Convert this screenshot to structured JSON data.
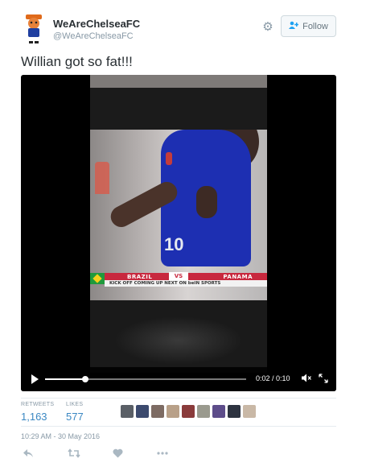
{
  "user": {
    "display_name": "WeAreChelseaFC",
    "screen_name": "@WeAreChelseaFC",
    "follow_label": "Follow",
    "follow_icon": "add-user-icon",
    "settings_icon": "gear-icon"
  },
  "tweet": {
    "text": "Willian got so fat!!!",
    "timestamp": "10:29 AM - 30 May 2016"
  },
  "video": {
    "overlay": {
      "team_left": "BRAZIL",
      "vs": "VS",
      "team_right": "PANAMA",
      "ticker": "KICK OFF COMING UP NEXT ON beIN SPORTS",
      "shirt_number": "10"
    },
    "time_display": "0:02 / 0:10",
    "progress_fraction": 0.2,
    "play_icon": "play-icon",
    "mute_icon": "mute-icon",
    "fullscreen_icon": "fullscreen-icon"
  },
  "stats": {
    "retweets_label": "RETWEETS",
    "retweets_value": "1,163",
    "likes_label": "LIKES",
    "likes_value": "577"
  },
  "likers": [
    {
      "color": "#5a5f66"
    },
    {
      "color": "#3c4a6e"
    },
    {
      "color": "#7d6b63"
    },
    {
      "color": "#b8a088"
    },
    {
      "color": "#8a3b3b"
    },
    {
      "color": "#9a9a8e"
    },
    {
      "color": "#5d4d8a"
    },
    {
      "color": "#2d3340"
    },
    {
      "color": "#c9b8a6"
    }
  ],
  "actions": {
    "reply_icon": "reply-icon",
    "retweet_icon": "retweet-icon",
    "like_icon": "heart-icon",
    "more_icon": "more-icon"
  }
}
